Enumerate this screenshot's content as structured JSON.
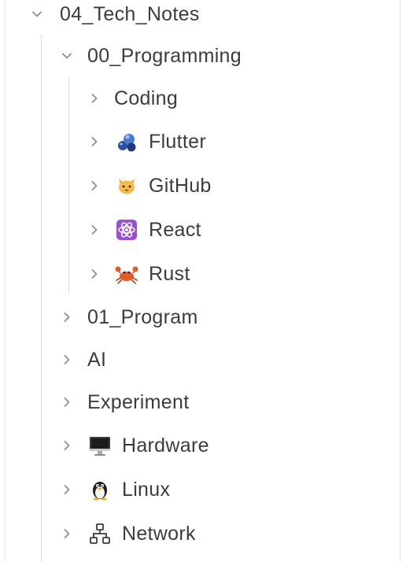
{
  "tree": {
    "root": {
      "label": "04_Tech_Notes",
      "expanded": true
    },
    "group": {
      "label": "00_Programming",
      "expanded": true
    },
    "group_children": [
      {
        "label": "Coding",
        "icon": "none"
      },
      {
        "label": "Flutter",
        "icon": "flutter-icon"
      },
      {
        "label": "GitHub",
        "icon": "cat-icon"
      },
      {
        "label": "React",
        "icon": "atom-icon"
      },
      {
        "label": "Rust",
        "icon": "crab-icon"
      }
    ],
    "siblings": [
      {
        "label": "01_Program",
        "icon": "none"
      },
      {
        "label": "AI",
        "icon": "none"
      },
      {
        "label": "Experiment",
        "icon": "none"
      },
      {
        "label": "Hardware",
        "icon": "desktop-computer-icon"
      },
      {
        "label": "Linux",
        "icon": "penguin-icon"
      },
      {
        "label": "Network",
        "icon": "network-icon"
      }
    ]
  },
  "colors": {
    "text": "#3c3c3c",
    "chevron": "#8e8e8e",
    "guide": "#d9d9d9",
    "background": "#ffffff"
  }
}
